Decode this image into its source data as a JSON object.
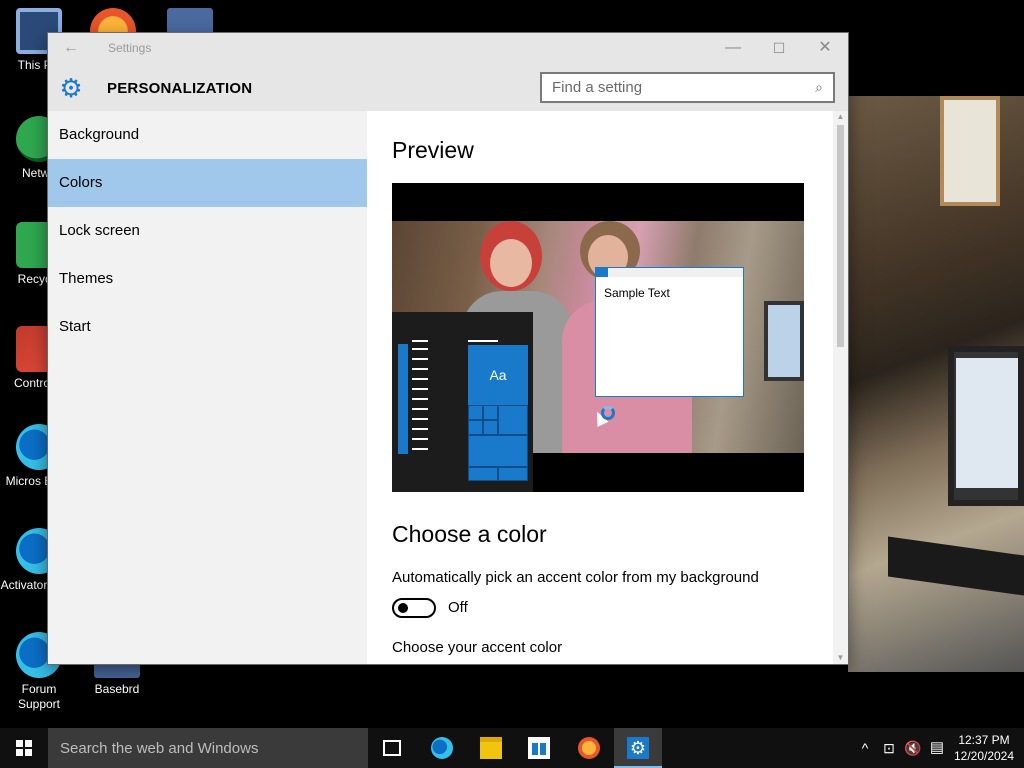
{
  "desktop": {
    "icons": [
      {
        "label": "This PC",
        "icon": "computer-icon"
      },
      {
        "label": "Netwo",
        "icon": "network-icon"
      },
      {
        "label": "Recycle",
        "icon": "recycle-bin-icon"
      },
      {
        "label": "Control P",
        "icon": "control-panel-icon"
      },
      {
        "label": "Micros Edge",
        "icon": "edge-icon"
      },
      {
        "label": "Activator Keys",
        "icon": "edge-icon"
      },
      {
        "label": "Forum Support",
        "icon": "edge-icon"
      },
      {
        "label": "Basebrd",
        "icon": "app-icon"
      }
    ]
  },
  "window": {
    "title": "Settings",
    "back_icon": "←",
    "minimize_icon": "—",
    "maximize_icon": "☐",
    "close_icon": "✕"
  },
  "header": {
    "section_title": "PERSONALIZATION",
    "gear_icon": "⚙",
    "search_placeholder": "Find a setting",
    "search_icon": "⌕"
  },
  "sidebar": {
    "items": [
      {
        "label": "Background",
        "selected": false
      },
      {
        "label": "Colors",
        "selected": true
      },
      {
        "label": "Lock screen",
        "selected": false
      },
      {
        "label": "Themes",
        "selected": false
      },
      {
        "label": "Start",
        "selected": false
      }
    ]
  },
  "content": {
    "preview_heading": "Preview",
    "preview": {
      "tile_label": "Aa",
      "sample_text": "Sample Text"
    },
    "choose_heading": "Choose a color",
    "auto_label": "Automatically pick an accent color from my background",
    "auto_toggle_state": "Off",
    "accent_label": "Choose your accent color"
  },
  "taskbar": {
    "search_placeholder": "Search the web and Windows",
    "apps": [
      "task-view",
      "edge",
      "file-explorer",
      "store",
      "firefox",
      "settings"
    ],
    "clock_time": "12:37 PM",
    "clock_date": "12/20/2024",
    "tray_chevron": "^",
    "tray_network": "⊡",
    "tray_volume": "🔇",
    "tray_action_center": "▤"
  },
  "colors": {
    "accent": "#1979ca",
    "selected_nav": "#9fc8eb",
    "titlebar": "#e6e6e6",
    "sidebar": "#f2f2f2"
  }
}
